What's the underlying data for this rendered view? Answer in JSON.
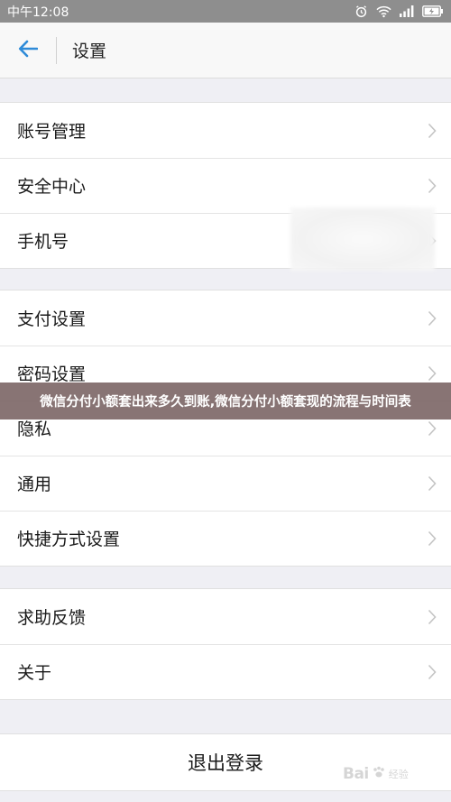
{
  "statusbar": {
    "time": "中午12:08"
  },
  "header": {
    "title": "设置"
  },
  "groups": [
    {
      "items": [
        {
          "label": "账号管理"
        },
        {
          "label": "安全中心"
        },
        {
          "label": "手机号"
        }
      ]
    },
    {
      "items": [
        {
          "label": "支付设置"
        },
        {
          "label": "密码设置"
        },
        {
          "label": "隐私"
        },
        {
          "label": "通用"
        },
        {
          "label": "快捷方式设置"
        }
      ]
    },
    {
      "items": [
        {
          "label": "求助反馈"
        },
        {
          "label": "关于"
        }
      ]
    }
  ],
  "banner": {
    "text": "微信分付小额套出来多久到账,微信分付小额套现的流程与时间表"
  },
  "logout": {
    "label": "退出登录"
  },
  "watermark": {
    "brand": "Bai",
    "sub": "经验"
  },
  "colors": {
    "accent": "#2f8bd8",
    "banner_bg": "#786161"
  }
}
